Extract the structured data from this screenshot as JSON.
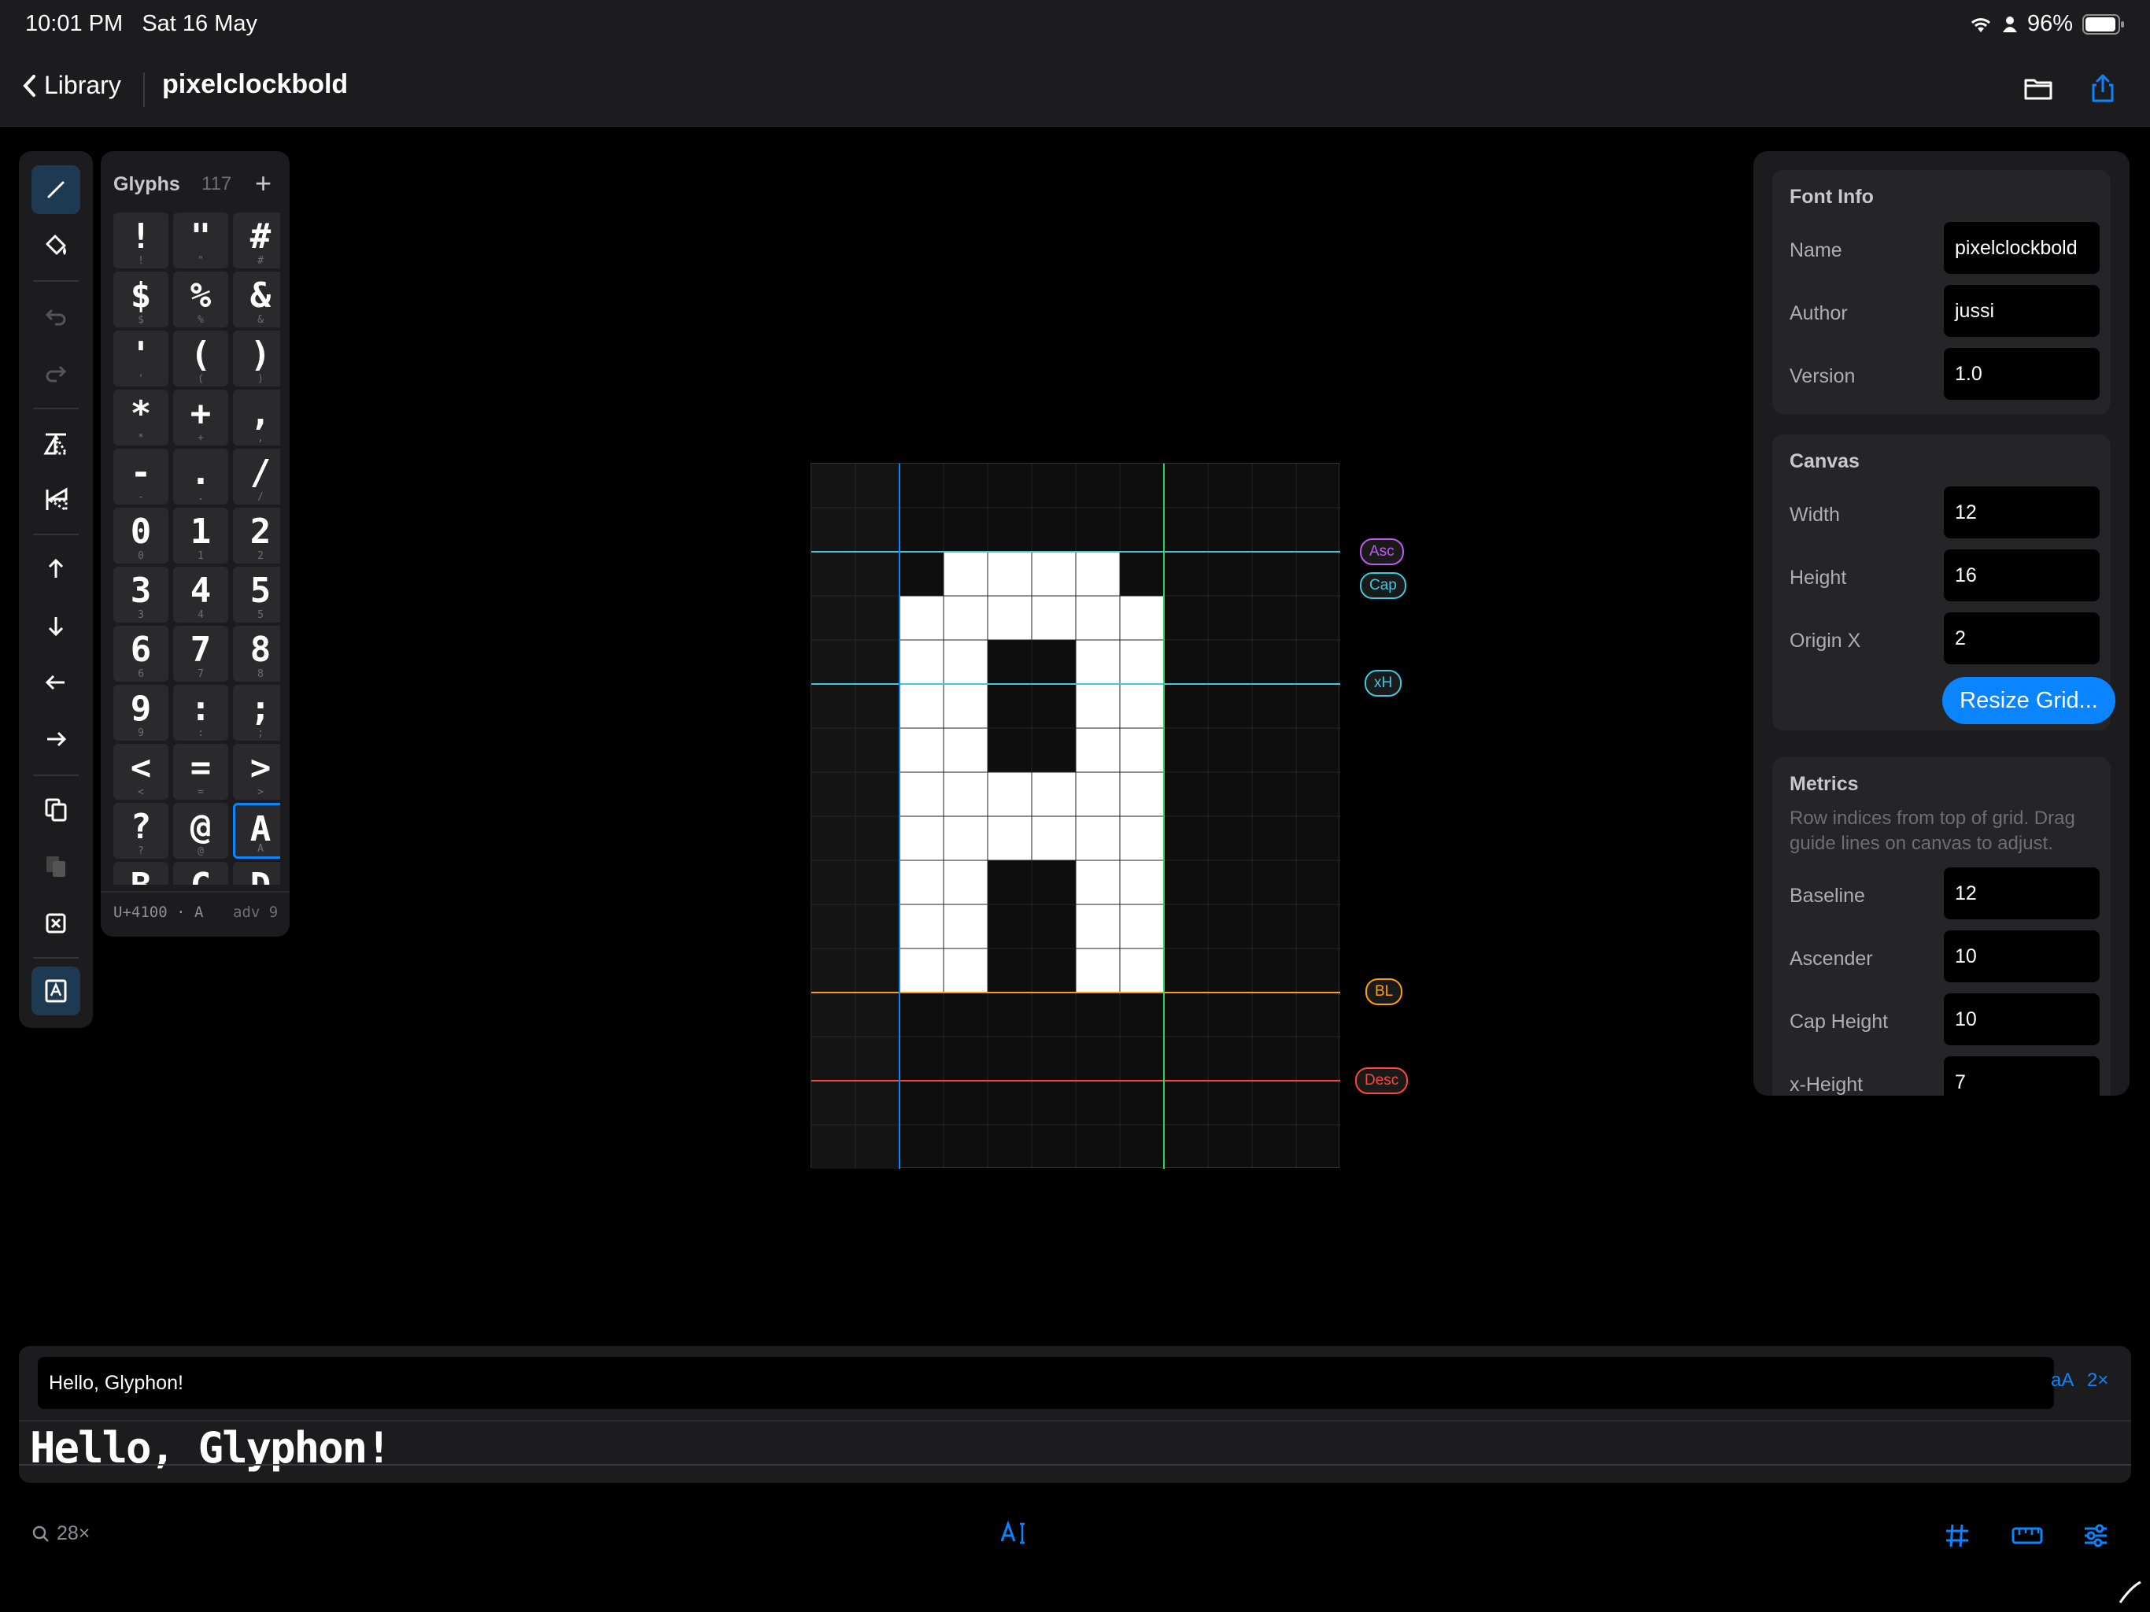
{
  "status": {
    "time": "10:01 PM",
    "date": "Sat 16 May",
    "battery": "96%"
  },
  "nav": {
    "back_label": "Library",
    "title": "pixelclockbold"
  },
  "glyphs_panel": {
    "title": "Glyphs",
    "count": "117",
    "add": "+",
    "cells": [
      {
        "ch": "!",
        "sub": "!"
      },
      {
        "ch": "\"",
        "sub": "\""
      },
      {
        "ch": "#",
        "sub": "#"
      },
      {
        "ch": "$",
        "sub": "$"
      },
      {
        "ch": "%",
        "sub": "%"
      },
      {
        "ch": "&",
        "sub": "&"
      },
      {
        "ch": "'",
        "sub": "'"
      },
      {
        "ch": "(",
        "sub": "("
      },
      {
        "ch": ")",
        "sub": ")"
      },
      {
        "ch": "*",
        "sub": "*"
      },
      {
        "ch": "+",
        "sub": "+"
      },
      {
        "ch": ",",
        "sub": ","
      },
      {
        "ch": "-",
        "sub": "-"
      },
      {
        "ch": ".",
        "sub": "."
      },
      {
        "ch": "/",
        "sub": "/"
      },
      {
        "ch": "0",
        "sub": "0"
      },
      {
        "ch": "1",
        "sub": "1"
      },
      {
        "ch": "2",
        "sub": "2"
      },
      {
        "ch": "3",
        "sub": "3"
      },
      {
        "ch": "4",
        "sub": "4"
      },
      {
        "ch": "5",
        "sub": "5"
      },
      {
        "ch": "6",
        "sub": "6"
      },
      {
        "ch": "7",
        "sub": "7"
      },
      {
        "ch": "8",
        "sub": "8"
      },
      {
        "ch": "9",
        "sub": "9"
      },
      {
        "ch": ":",
        "sub": ":"
      },
      {
        "ch": ";",
        "sub": ";"
      },
      {
        "ch": "<",
        "sub": "<"
      },
      {
        "ch": "=",
        "sub": "="
      },
      {
        "ch": ">",
        "sub": ">"
      },
      {
        "ch": "?",
        "sub": "?"
      },
      {
        "ch": "@",
        "sub": "@"
      },
      {
        "ch": "A",
        "sub": "A"
      },
      {
        "ch": "B",
        "sub": "B"
      },
      {
        "ch": "C",
        "sub": "C"
      },
      {
        "ch": "D",
        "sub": "D"
      }
    ],
    "selected": "A",
    "footer_code": "U+4100 · A",
    "footer_adv": "adv 9"
  },
  "canvas": {
    "grid_cols": 12,
    "grid_rows": 16,
    "guides": {
      "asc": "Asc",
      "cap": "Cap",
      "xh": "xH",
      "bl": "BL",
      "desc": "Desc"
    },
    "colors": {
      "asc": "#bf5af2",
      "cap": "#40c8e0",
      "xh": "#40c8e0",
      "bl": "#ff9f0a",
      "desc": "#ff453a",
      "origin": "#0a84ff",
      "advance": "#30d158"
    }
  },
  "inspector": {
    "font_info": {
      "title": "Font Info",
      "name_label": "Name",
      "name_value": "pixelclockbold",
      "author_label": "Author",
      "author_value": "jussi",
      "version_label": "Version",
      "version_value": "1.0"
    },
    "canvas": {
      "title": "Canvas",
      "width_label": "Width",
      "width_value": "12",
      "height_label": "Height",
      "height_value": "16",
      "originx_label": "Origin X",
      "originx_value": "2",
      "resize_button": "Resize Grid..."
    },
    "metrics": {
      "title": "Metrics",
      "desc": "Row indices from top of grid. Drag guide lines on canvas to adjust.",
      "baseline_label": "Baseline",
      "baseline_value": "12",
      "ascender_label": "Ascender",
      "ascender_value": "10",
      "capheight_label": "Cap Height",
      "capheight_value": "10",
      "xheight_label": "x-Height",
      "xheight_value": "7"
    }
  },
  "preview": {
    "input_value": "Hello, Glyphon!",
    "aa_label": "aA",
    "scale_label": "2×",
    "rendered": "Hello, Glyphon!"
  },
  "bottom": {
    "zoom": "28×"
  }
}
